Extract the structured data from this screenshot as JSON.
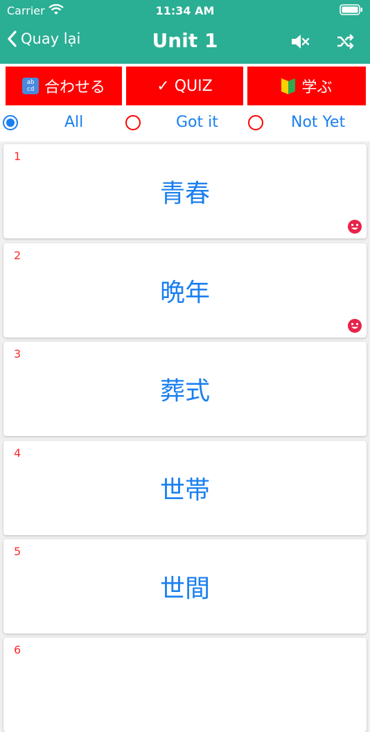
{
  "status": {
    "carrier": "Carrier",
    "time": "11:34 AM"
  },
  "nav": {
    "back_label": "Quay lại",
    "title": "Unit 1"
  },
  "modes": [
    {
      "label": "合わせる",
      "icon": "abcd-icon"
    },
    {
      "label": "✓ QUIZ"
    },
    {
      "label": "学ぶ",
      "icon": "beginner-mark-icon"
    }
  ],
  "filters": [
    {
      "label": "All",
      "selected": true
    },
    {
      "label": "Got it",
      "selected": false
    },
    {
      "label": "Not Yet",
      "selected": false
    }
  ],
  "cards": [
    {
      "num": "1",
      "word": "青春",
      "got_it": true
    },
    {
      "num": "2",
      "word": "晩年",
      "got_it": true
    },
    {
      "num": "3",
      "word": "葬式",
      "got_it": false
    },
    {
      "num": "4",
      "word": "世帯",
      "got_it": false
    },
    {
      "num": "5",
      "word": "世間",
      "got_it": false
    },
    {
      "num": "6",
      "word": "",
      "got_it": false
    }
  ],
  "colors": {
    "header": "#2aae94",
    "mode_button": "#ff0000",
    "accent": "#1a7ff0",
    "number": "#ff2a2a"
  }
}
